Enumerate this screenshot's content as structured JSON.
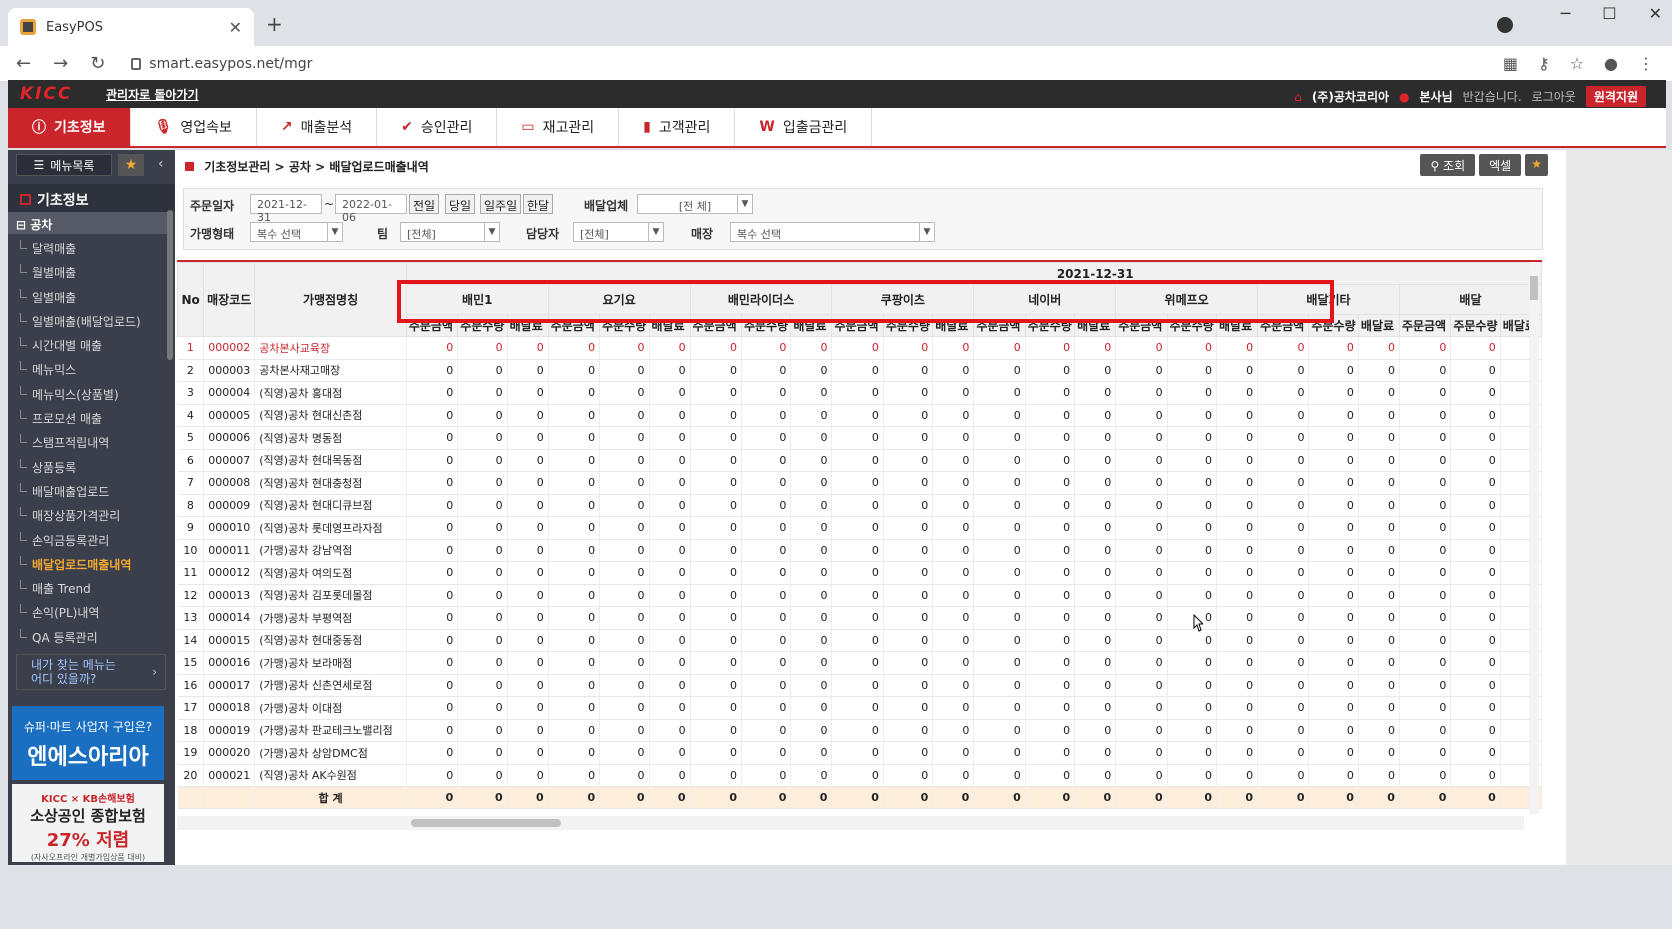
{
  "browser": {
    "tab_title": "EasyPOS",
    "url": "smart.easypos.net/mgr",
    "win_min": "─",
    "win_max": "☐",
    "win_close": "✕",
    "new_tab": "+"
  },
  "topbar": {
    "logo": "KICC",
    "back_admin": "관리자로 돌아가기",
    "company": "(주)공차코리아",
    "branch": "본사님",
    "greeting": "반갑습니다.",
    "logout": "로그아웃",
    "remote": "원격지원"
  },
  "nav": [
    {
      "label": "기초정보",
      "icon": "ⓘ",
      "active": true
    },
    {
      "label": "영업속보",
      "icon": "🎙"
    },
    {
      "label": "매출분석",
      "icon": "↗"
    },
    {
      "label": "승인관리",
      "icon": "✔"
    },
    {
      "label": "재고관리",
      "icon": "▭"
    },
    {
      "label": "고객관리",
      "icon": "▮"
    },
    {
      "label": "입출금관리",
      "icon": "W"
    }
  ],
  "sidebar": {
    "menu_button": "메뉴목록",
    "title": "기초정보",
    "group": "공차",
    "items": [
      "달력매출",
      "월별매출",
      "일별매출",
      "일별매출(배달업로드)",
      "시간대별 매출",
      "메뉴믹스",
      "메뉴믹스(상품별)",
      "프로모션 매출",
      "스탬프적립내역",
      "상품등록",
      "배달매출업로드",
      "매장상품가격관리",
      "손익금등록관리",
      "배달업로드매출내역",
      "매출 Trend",
      "손익(PL)내역",
      "QA 등록관리"
    ],
    "active_index": 13,
    "find_menu_line1": "내가 찾는 메뉴는",
    "find_menu_line2": "어디 있을까?",
    "ad1_small": "슈퍼·마트 사업자 구입은?",
    "ad1_big": "엔에스아리아",
    "ad2_head": "KICC × KB손해보험",
    "ad2_main": "소상공인 종합보험",
    "ad2_rate": "27% 저렴",
    "ad2_note": "(자사오프라인 개별가입상품 대비)"
  },
  "breadcrumb": {
    "l1": "기초정보관리",
    "l2": "공차",
    "l3": "배달업로드매출내역",
    "sep": ">"
  },
  "actions": {
    "search": "조회",
    "excel": "엑셀"
  },
  "filters": {
    "order_date_label": "주문일자",
    "date_from": "2021-12-31",
    "tilde": "~",
    "date_to": "2022-01-06",
    "btn_prev": "전일",
    "btn_today": "당일",
    "btn_week": "일주일",
    "btn_month": "한달",
    "delivery_label": "배달업체",
    "delivery_value": "[전 체]",
    "franchise_label": "가맹형태",
    "franchise_value": "복수 선택",
    "team_label": "팀",
    "team_value": "[전체]",
    "manager_label": "담당자",
    "manager_value": "[전체]",
    "store_label": "매장",
    "store_value": "복수 선택"
  },
  "grid": {
    "date": "2021-12-31",
    "col_no": "No",
    "col_code": "매장코드",
    "col_name": "가맹점명칭",
    "vendors": [
      "배민1",
      "요기요",
      "배민라이더스",
      "쿠팡이츠",
      "네이버",
      "위메프오",
      "배달기타",
      "배달"
    ],
    "sub_cols": [
      "주문금액",
      "주문수량",
      "배달료"
    ],
    "rows": [
      {
        "no": "1",
        "code": "000002",
        "name": "공차본사교육장"
      },
      {
        "no": "2",
        "code": "000003",
        "name": "공차본사재고매장"
      },
      {
        "no": "3",
        "code": "000004",
        "name": "(직영)공차 홍대점"
      },
      {
        "no": "4",
        "code": "000005",
        "name": "(직영)공차 현대신촌점"
      },
      {
        "no": "5",
        "code": "000006",
        "name": "(직영)공차 명동점"
      },
      {
        "no": "6",
        "code": "000007",
        "name": "(직영)공차 현대목동점"
      },
      {
        "no": "7",
        "code": "000008",
        "name": "(직영)공차 현대충청점"
      },
      {
        "no": "8",
        "code": "000009",
        "name": "(직영)공차 현대디큐브점"
      },
      {
        "no": "9",
        "code": "000010",
        "name": "(직영)공차 롯데영프라자점"
      },
      {
        "no": "10",
        "code": "000011",
        "name": "(가맹)공차 강남역점"
      },
      {
        "no": "11",
        "code": "000012",
        "name": "(직영)공차 여의도점"
      },
      {
        "no": "12",
        "code": "000013",
        "name": "(직영)공차 김포롯데몰점"
      },
      {
        "no": "13",
        "code": "000014",
        "name": "(가맹)공차 부평역점"
      },
      {
        "no": "14",
        "code": "000015",
        "name": "(직영)공차 현대중동점"
      },
      {
        "no": "15",
        "code": "000016",
        "name": "(가맹)공차 보라매점"
      },
      {
        "no": "16",
        "code": "000017",
        "name": "(가맹)공차 신촌연세로점"
      },
      {
        "no": "17",
        "code": "000018",
        "name": "(가맹)공차 이대점"
      },
      {
        "no": "18",
        "code": "000019",
        "name": "(가맹)공차 판교테크노밸리점"
      },
      {
        "no": "19",
        "code": "000020",
        "name": "(가맹)공차 상암DMC점"
      },
      {
        "no": "20",
        "code": "000021",
        "name": "(직영)공차 AK수원점"
      }
    ],
    "zero": "0",
    "sum_label": "합 계"
  },
  "colors": {
    "accent": "#c9252b",
    "highlight_box": "#e4141b",
    "sum_row": "#fdeedb"
  }
}
